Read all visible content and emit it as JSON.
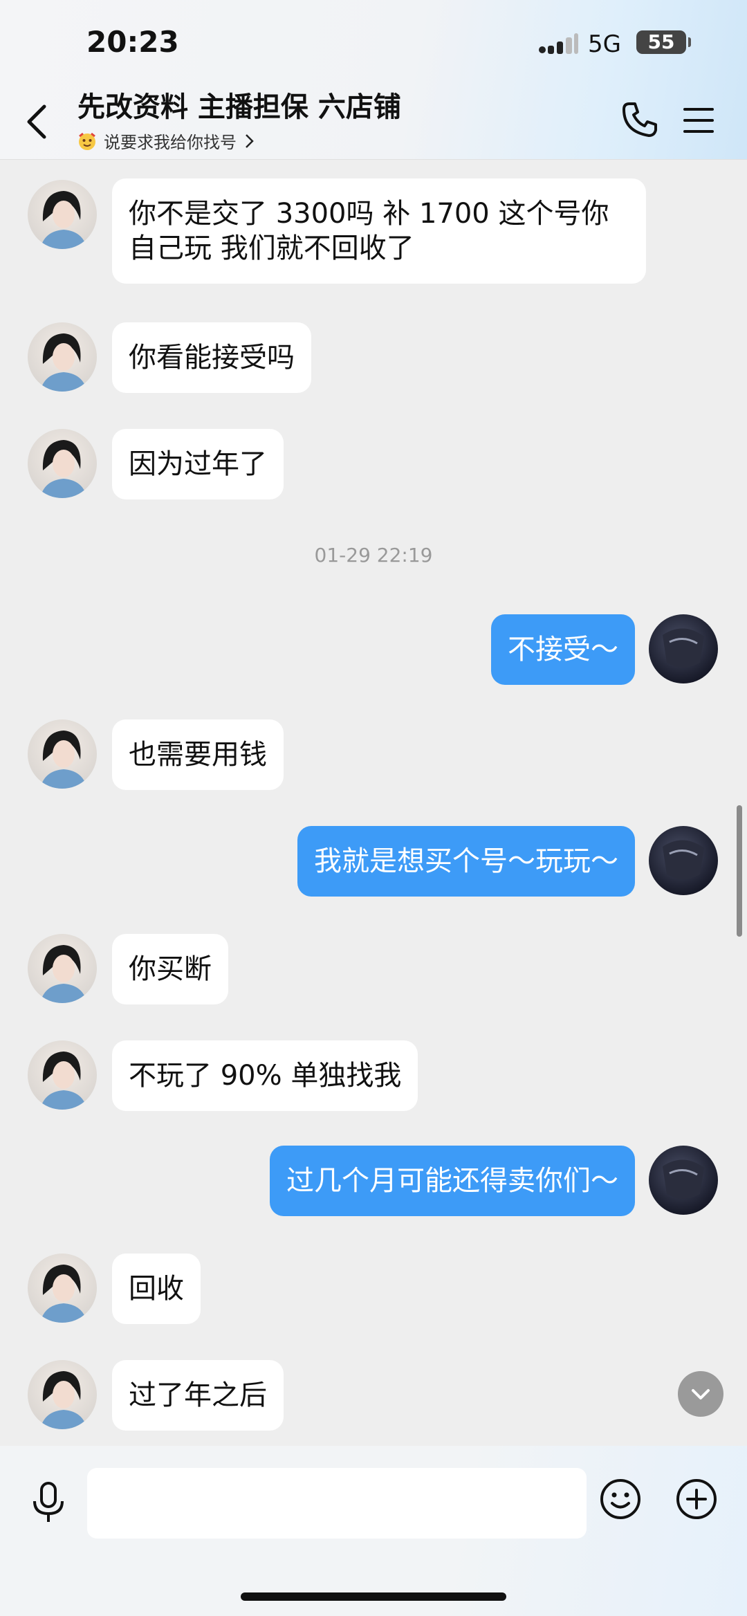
{
  "status_bar": {
    "time": "20:23",
    "network": "5G",
    "battery": "55"
  },
  "header": {
    "title": "先改资料 主播担保 六店铺",
    "subtitle": "说要求我给你找号"
  },
  "messages": [
    {
      "side": "left",
      "lines": [
        "你不是交了 3300吗  补 1700 这个号你",
        "自己玩 我们就不回收了"
      ]
    },
    {
      "side": "left",
      "lines": [
        "你看能接受吗"
      ]
    },
    {
      "side": "left",
      "lines": [
        "因为过年了"
      ]
    },
    {
      "side": "right",
      "lines": [
        "不接受～"
      ]
    },
    {
      "side": "left",
      "lines": [
        "也需要用钱"
      ]
    },
    {
      "side": "right",
      "lines": [
        "我就是想买个号～玩玩～"
      ]
    },
    {
      "side": "left",
      "lines": [
        "你买断"
      ]
    },
    {
      "side": "left",
      "lines": [
        "不玩了 90% 单独找我"
      ]
    },
    {
      "side": "right",
      "lines": [
        "过几个月可能还得卖你们～"
      ]
    },
    {
      "side": "left",
      "lines": [
        "回收"
      ]
    },
    {
      "side": "left",
      "lines": [
        "过了年之后"
      ]
    }
  ],
  "timestamp": "01-29 22:19",
  "colors": {
    "outgoing_bubble": "#3d9bf7",
    "incoming_bubble": "#ffffff",
    "background": "#eeeeee"
  },
  "icons": [
    "back-arrow-icon",
    "phone-icon",
    "menu-icon",
    "mic-icon",
    "emoji-icon",
    "plus-icon",
    "chevron-down-icon",
    "signal-icon"
  ]
}
